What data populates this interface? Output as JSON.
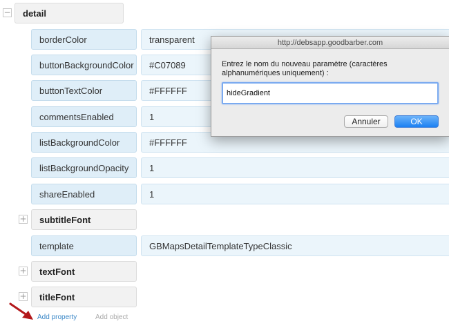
{
  "tree": {
    "root": {
      "label": "detail",
      "toggle": "−"
    },
    "rows": [
      {
        "key": "borderColor",
        "value": "transparent"
      },
      {
        "key": "buttonBackgroundColor",
        "value": "#C07089"
      },
      {
        "key": "buttonTextColor",
        "value": "#FFFFFF"
      },
      {
        "key": "commentsEnabled",
        "value": "1"
      },
      {
        "key": "listBackgroundColor",
        "value": "#FFFFFF"
      },
      {
        "key": "listBackgroundOpacity",
        "value": "1"
      },
      {
        "key": "shareEnabled",
        "value": "1"
      }
    ],
    "subtitle_font": {
      "label": "subtitleFont",
      "toggle": "+"
    },
    "template": {
      "key": "template",
      "value": "GBMapsDetailTemplateTypeClassic"
    },
    "text_font": {
      "label": "textFont",
      "toggle": "+"
    },
    "title_font": {
      "label": "titleFont",
      "toggle": "+"
    }
  },
  "actions": {
    "add_property": "Add property",
    "add_object": "Add object"
  },
  "dialog": {
    "title": "http://debsapp.goodbarber.com",
    "message": "Entrez le nom du nouveau paramètre (caractères alphanumériques uniquement) :",
    "input_value": "hideGradient",
    "cancel_label": "Annuler",
    "ok_label": "OK"
  },
  "colors": {
    "key_bg": "#dfeef8",
    "value_bg": "#ebf5fb",
    "object_bg": "#f2f2f2",
    "link": "#3a87c7",
    "annotation_arrow": "#b3181b",
    "ok_button": "#1b80f2"
  }
}
